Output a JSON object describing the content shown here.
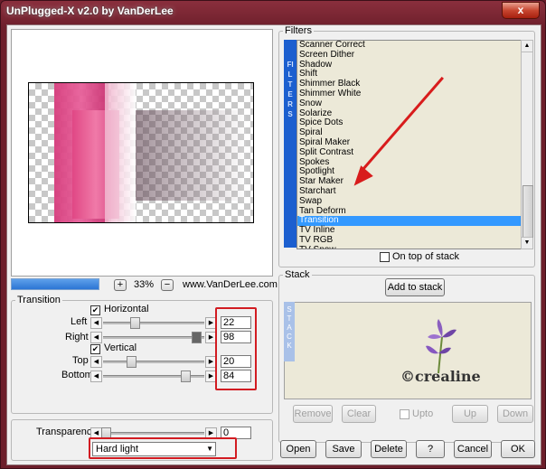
{
  "window": {
    "title": "UnPlugged-X v2.0 by VanDerLee",
    "close_glyph": "x"
  },
  "toolbar": {
    "zoom_in": "+",
    "zoom_value": "33%",
    "zoom_out": "−",
    "website": "www.VanDerLee.com"
  },
  "transition": {
    "group_label": "Transition",
    "horizontal_label": "Horizontal",
    "horizontal_checked": "✔",
    "vertical_label": "Vertical",
    "vertical_checked": "✔",
    "left_label": "Left",
    "left_value": "22",
    "right_label": "Right",
    "right_value": "98",
    "top_label": "Top",
    "top_value": "20",
    "bottom_label": "Bottom",
    "bottom_value": "84"
  },
  "transparency": {
    "label": "Transparency",
    "value": "0"
  },
  "blend": {
    "selected": "Hard light"
  },
  "filters": {
    "group_label": "Filters",
    "side_label": "FILTERS",
    "items": [
      "Scanner Correct",
      "Screen Dither",
      "Shadow",
      "Shift",
      "Shimmer Black",
      "Shimmer White",
      "Snow",
      "Solarize",
      "Spice Dots",
      "Spiral",
      "Spiral Maker",
      "Split Contrast",
      "Spokes",
      "Spotlight",
      "Star Maker",
      "Starchart",
      "Swap",
      "Tan Deform",
      "Transition",
      "TV Inline",
      "TV RGB",
      "TV Snow"
    ],
    "selected_index": 18,
    "on_top_label": "On top of stack"
  },
  "stack": {
    "group_label": "Stack",
    "add_button": "Add to stack",
    "side_label": "STACK",
    "watermark": "©crealine",
    "remove": "Remove",
    "clear": "Clear",
    "upto": "Upto",
    "up": "Up",
    "down": "Down"
  },
  "buttons": {
    "open": "Open",
    "save": "Save",
    "delete": "Delete",
    "help": "?",
    "cancel": "Cancel",
    "ok": "OK"
  },
  "colors": {
    "accent": "#d21c22",
    "selection": "#3399ff"
  }
}
